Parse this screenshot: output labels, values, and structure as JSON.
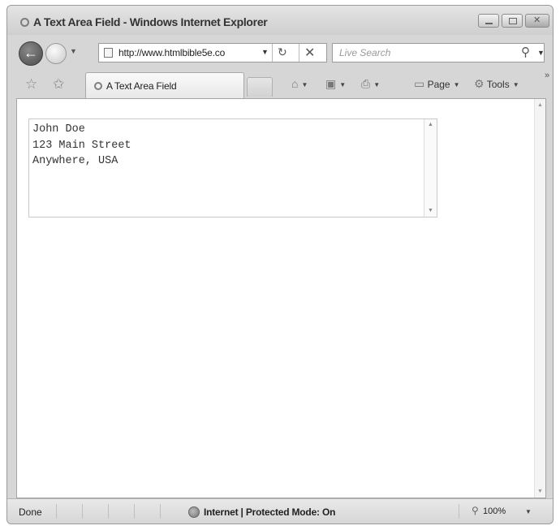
{
  "window": {
    "title": "A Text Area Field - Windows Internet Explorer"
  },
  "address_bar": {
    "url": "http://www.htmlbible5e.co"
  },
  "search": {
    "placeholder": "Live Search"
  },
  "tab": {
    "label": "A Text Area Field"
  },
  "commands": {
    "page_label": "Page",
    "tools_label": "Tools"
  },
  "textarea": {
    "value": "John Doe\n123 Main Street\nAnywhere, USA"
  },
  "status": {
    "left": "Done",
    "zone": "Internet | Protected Mode: On",
    "zoom": "100%"
  },
  "icons": {
    "back": "back-arrow-icon",
    "forward": "forward-icon",
    "refresh": "refresh-icon",
    "stop": "stop-icon",
    "search": "search-icon",
    "favorites": "favorites-star-icon",
    "add_favorites": "add-favorites-icon",
    "home": "home-icon",
    "feeds": "feeds-icon",
    "print": "print-icon",
    "page": "page-icon",
    "tools": "tools-icon",
    "globe": "globe-icon",
    "zoom": "zoom-icon"
  },
  "colors": {
    "chrome": "#d6d6d6",
    "content_bg": "#ffffff"
  }
}
